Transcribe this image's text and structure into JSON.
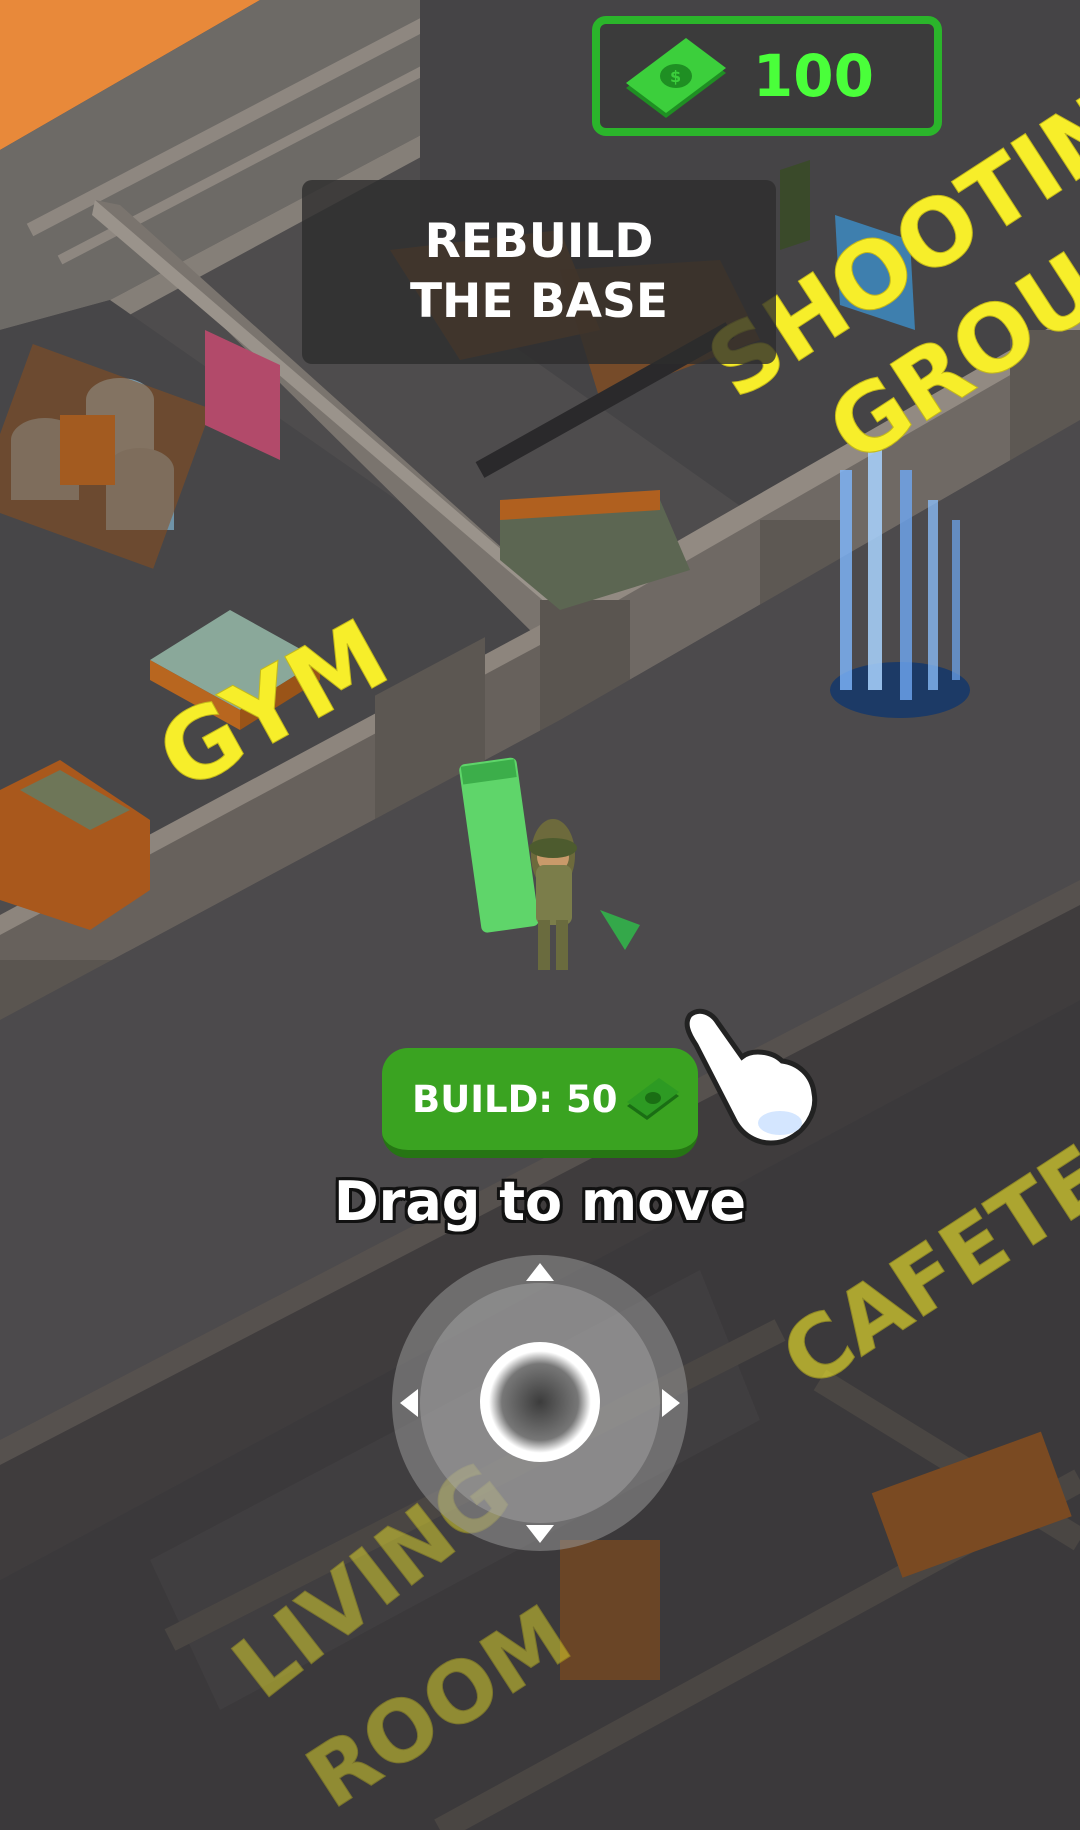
{
  "hud": {
    "money": "100",
    "money_icon": "cash-bill-icon",
    "accent_color": "#2bb52b"
  },
  "objective": {
    "line1": "REBUILD",
    "line2": "THE BASE"
  },
  "zones": {
    "gym": "GYM",
    "shooting_line1": "SHOOTIN",
    "shooting_line2": "GROU",
    "cafeteria": "CAFETE",
    "living_line1": "LIVING",
    "living_line2": "ROOM"
  },
  "build_button": {
    "label": "BUILD: 50",
    "icon": "cash-bill-icon"
  },
  "tutorial": {
    "hint": "Drag to move",
    "hand_icon": "pointing-hand-icon"
  },
  "joystick": {
    "arrows": [
      "up",
      "down",
      "left",
      "right"
    ]
  }
}
